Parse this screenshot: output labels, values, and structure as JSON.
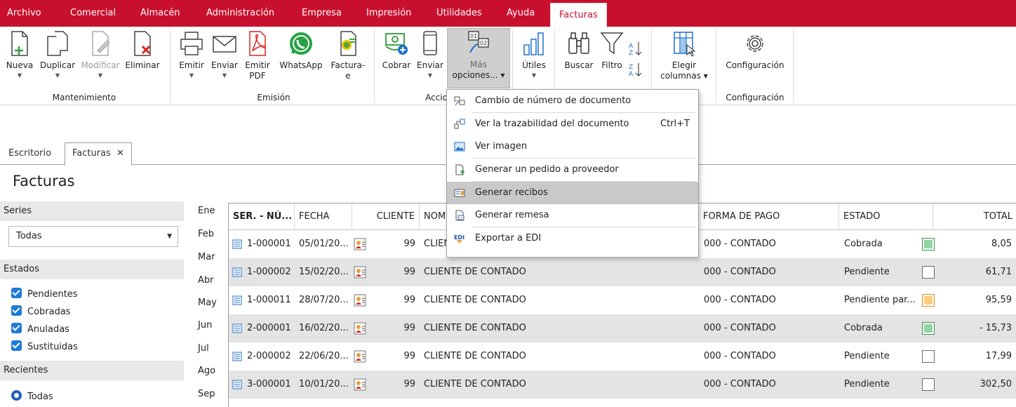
{
  "menubar": {
    "items": [
      "Archivo",
      "Comercial",
      "Almacén",
      "Administración",
      "Empresa",
      "Impresión",
      "Utilidades",
      "Ayuda",
      "Facturas"
    ]
  },
  "ribbon": {
    "buttons": {
      "nueva": "Nueva",
      "duplicar": "Duplicar",
      "modificar": "Modificar",
      "eliminar": "Eliminar",
      "emitir": "Emitir",
      "enviar_emision": "Enviar",
      "emitir_pdf_1": "Emitir",
      "emitir_pdf_2": "PDF",
      "whatsapp": "WhatsApp",
      "facturae_1": "Factura-",
      "facturae_2": "e",
      "cobrar": "Cobrar",
      "enviar_acciones": "Enviar",
      "mas_opciones_1": "Más",
      "mas_opciones_2": "opciones... ▾",
      "utiles": "Útiles",
      "buscar": "Buscar",
      "filtro": "Filtro",
      "elegir_columnas_1": "Elegir",
      "elegir_columnas_2": "columnas ▾",
      "configuracion": "Configuración"
    },
    "groups": {
      "mantenimiento": "Mantenimiento",
      "emision": "Emisión",
      "acciones": "Accio",
      "configuracion": "Configuración"
    },
    "colors": {
      "menubar": "#c8102e",
      "whatsapp": "#25a244",
      "acrobat": "#d7261e",
      "selected_check": "#1f7bd8"
    }
  },
  "dropdown": {
    "items": [
      {
        "label": "Cambio de número de documento",
        "shortcut": ""
      },
      {
        "label": "Ver la trazabilidad del documento",
        "shortcut": "Ctrl+T"
      },
      {
        "label": "Ver imagen",
        "shortcut": ""
      },
      {
        "label": "Generar un pedido a proveedor",
        "shortcut": ""
      },
      {
        "label": "Generar recibos",
        "shortcut": ""
      },
      {
        "label": "Generar remesa",
        "shortcut": ""
      },
      {
        "label": "Exportar a EDI",
        "shortcut": ""
      }
    ]
  },
  "tabs": {
    "escritorio": "Escritorio",
    "facturas": "Facturas",
    "close": "✕"
  },
  "page": {
    "title": "Facturas"
  },
  "sidebar": {
    "series_header": "Series",
    "series_selected": "Todas",
    "estados_header": "Estados",
    "estados": [
      "Pendientes",
      "Cobradas",
      "Anuladas",
      "Sustituidas"
    ],
    "recientes_header": "Recientes",
    "recientes_selected": "Todas"
  },
  "months": [
    "Ene",
    "Feb",
    "Mar",
    "Abr",
    "May",
    "Jun",
    "Jul",
    "Ago",
    "Sep"
  ],
  "grid": {
    "columns": {
      "serie": "SER. - NÚ...",
      "fecha": "FECHA",
      "cliente": "CLIENTE",
      "nombre": "NOM",
      "forma_pago": "FORMA DE PAGO",
      "estado": "ESTADO",
      "total": "TOTAL"
    },
    "rows": [
      {
        "num": "1-000001",
        "fecha": "05/01/20...",
        "cliente": "99",
        "nombre": "CLIEN",
        "forma_pago": "000 - CONTADO",
        "estado": "Cobrada",
        "status": "green",
        "total": "8,05"
      },
      {
        "num": "1-000002",
        "fecha": "15/02/20...",
        "cliente": "99",
        "nombre": "CLIENTE DE CONTADO",
        "forma_pago": "000 - CONTADO",
        "estado": "Pendiente",
        "status": "empty",
        "total": "61,71"
      },
      {
        "num": "1-000011",
        "fecha": "28/07/20...",
        "cliente": "99",
        "nombre": "CLIENTE DE CONTADO",
        "forma_pago": "000 - CONTADO",
        "estado": "Pendiente par...",
        "status": "orange",
        "total": "95,59"
      },
      {
        "num": "2-000001",
        "fecha": "16/02/20...",
        "cliente": "99",
        "nombre": "CLIENTE DE CONTADO",
        "forma_pago": "000 - CONTADO",
        "estado": "Cobrada",
        "status": "green",
        "total": "- 15,73"
      },
      {
        "num": "2-000002",
        "fecha": "22/06/20...",
        "cliente": "99",
        "nombre": "CLIENTE DE CONTADO",
        "forma_pago": "000 - CONTADO",
        "estado": "Pendiente",
        "status": "empty",
        "total": "17,99"
      },
      {
        "num": "3-000001",
        "fecha": "10/01/20...",
        "cliente": "99",
        "nombre": "CLIENTE DE CONTADO",
        "forma_pago": "000 - CONTADO",
        "estado": "Pendiente",
        "status": "empty",
        "total": "302,50"
      }
    ]
  }
}
